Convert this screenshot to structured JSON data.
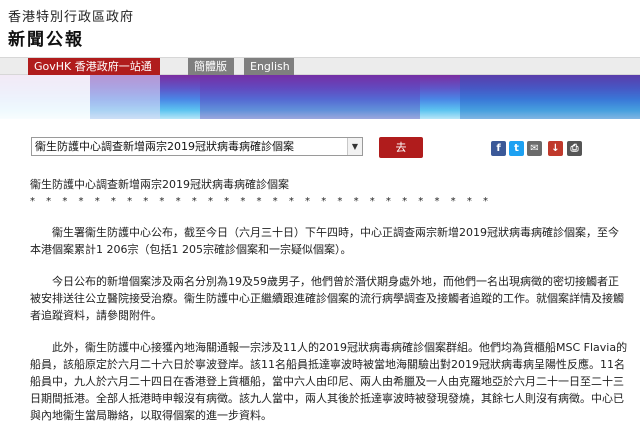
{
  "header": {
    "gov_name": "香港特別行政區政府",
    "site_title": "新聞公報"
  },
  "nav": {
    "govhk": "GovHK 香港政府一站通",
    "simplified": "簡體版",
    "english": "English"
  },
  "article_select": {
    "selected": "衞生防護中心調查新增兩宗2019冠狀病毒病確診個案"
  },
  "go_button": "去",
  "share_icons": [
    "facebook-icon",
    "twitter-icon",
    "email-icon",
    "download-icon",
    "print-icon"
  ],
  "colors": {
    "accent": "#b01c1c",
    "nav_gray": "#7f7f7f"
  },
  "article": {
    "title": "衞生防護中心調查新增兩宗2019冠狀病毒病確診個案",
    "stars": "* * * * * * * * * * * * * * * * * * * * * * * * * * * * *",
    "paragraphs": [
      "衞生署衞生防護中心公布，截至今日（六月三十日）下午四時，中心正調查兩宗新增2019冠狀病毒病確診個案，至今本港個案累計1 206宗（包括1 205宗確診個案和一宗疑似個案）。",
      "今日公布的新增個案涉及兩名分別為19及59歲男子，他們曾於潛伏期身處外地，而他們一名出現病徵的密切接觸者正被安排送往公立醫院接受治療。衞生防護中心正繼續跟進確診個案的流行病學調查及接觸者追蹤的工作。就個案詳情及接觸者追蹤資料，請參閱附件。",
      "此外，衞生防護中心接獲內地海關通報一宗涉及11人的2019冠狀病毒病確診個案群組。他們均為貨櫃船MSC Flavia的船員，該船原定於六月二十六日於寧波登岸。該11名船員抵達寧波時被當地海關驗出對2019冠狀病毒病呈陽性反應。11名船員中，九人於六月二十四日在香港登上貨櫃船，當中六人由印尼、兩人由希臘及一人由克羅地亞於六月二十一日至二十三日期間抵港。全部人抵港時申報沒有病徵。該九人當中，兩人其後於抵達寧波時被發現發燒，其餘七人則沒有病徵。中心已與內地衞生當局聯絡，以取得個案的進一步資料。"
    ]
  }
}
